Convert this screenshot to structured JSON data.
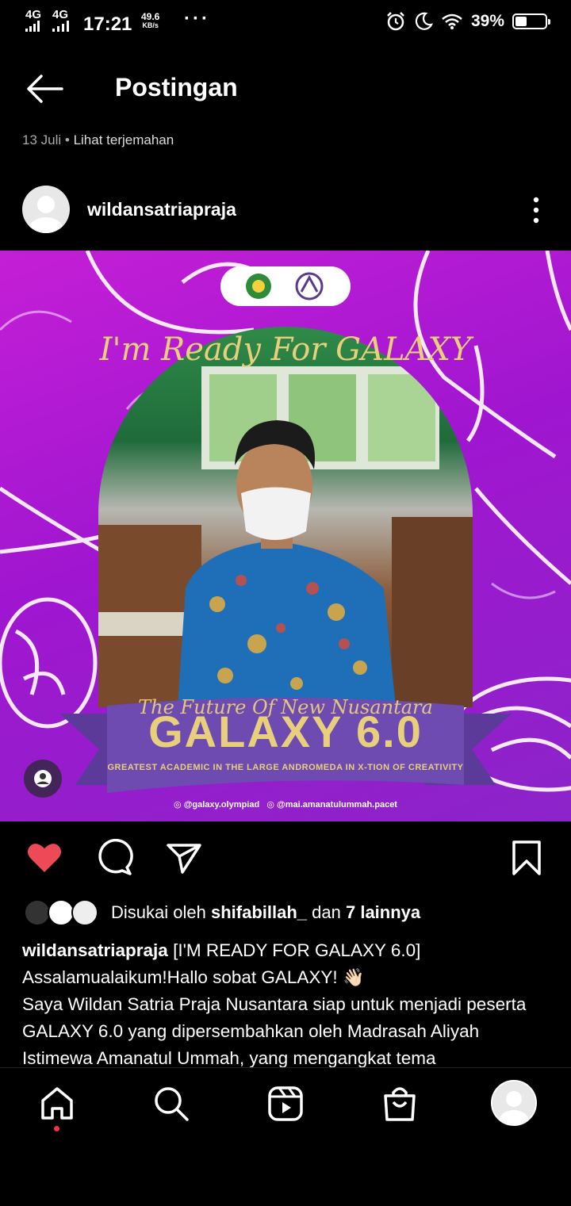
{
  "status_bar": {
    "network1": "4G",
    "network2": "4G",
    "time": "17:21",
    "speed_value": "49.6",
    "speed_unit": "KB/s",
    "more_dots": "···",
    "battery_percent": "39%",
    "battery_level": 0.39
  },
  "header": {
    "title": "Postingan",
    "date": "13 Juli",
    "separator": "•",
    "translate_link": "Lihat terjemahan"
  },
  "post": {
    "username": "wildansatriapraja",
    "image": {
      "ready_text": "I'm Ready For GALAXY",
      "future_text": "The Future Of New Nusantara",
      "event_name": "GALAXY 6.0",
      "event_subtitle": "GREATEST ACADEMIC IN THE LARGE ANDROMEDA IN X-TION OF CREATIVITY",
      "handle1": "@galaxy.olympiad",
      "handle2": "@mai.amanatulummah.pacet",
      "bg_color": "#b61ad3",
      "accent_gold": "#e8cf7c"
    },
    "likes": {
      "prefix": "Disukai oleh",
      "user": "shifabillah_",
      "connector": "dan",
      "others": "7 lainnya"
    },
    "caption": {
      "username": "wildansatriapraja",
      "line1": "[I'M READY FOR GALAXY 6.0]",
      "line2": "Assalamualaikum!Hallo sobat GALAXY!",
      "line2_emoji": "👋🏻",
      "line3": "Saya Wildan Satria Praja Nusantara siap untuk menjadi peserta GALAXY 6.0 yang dipersembahkan oleh Madrasah Aliyah Istimewa Amanatul Ummah, yang mengangkat tema"
    }
  },
  "colors": {
    "like_red": "#ed4956",
    "nav_dot": "#ff3040"
  }
}
